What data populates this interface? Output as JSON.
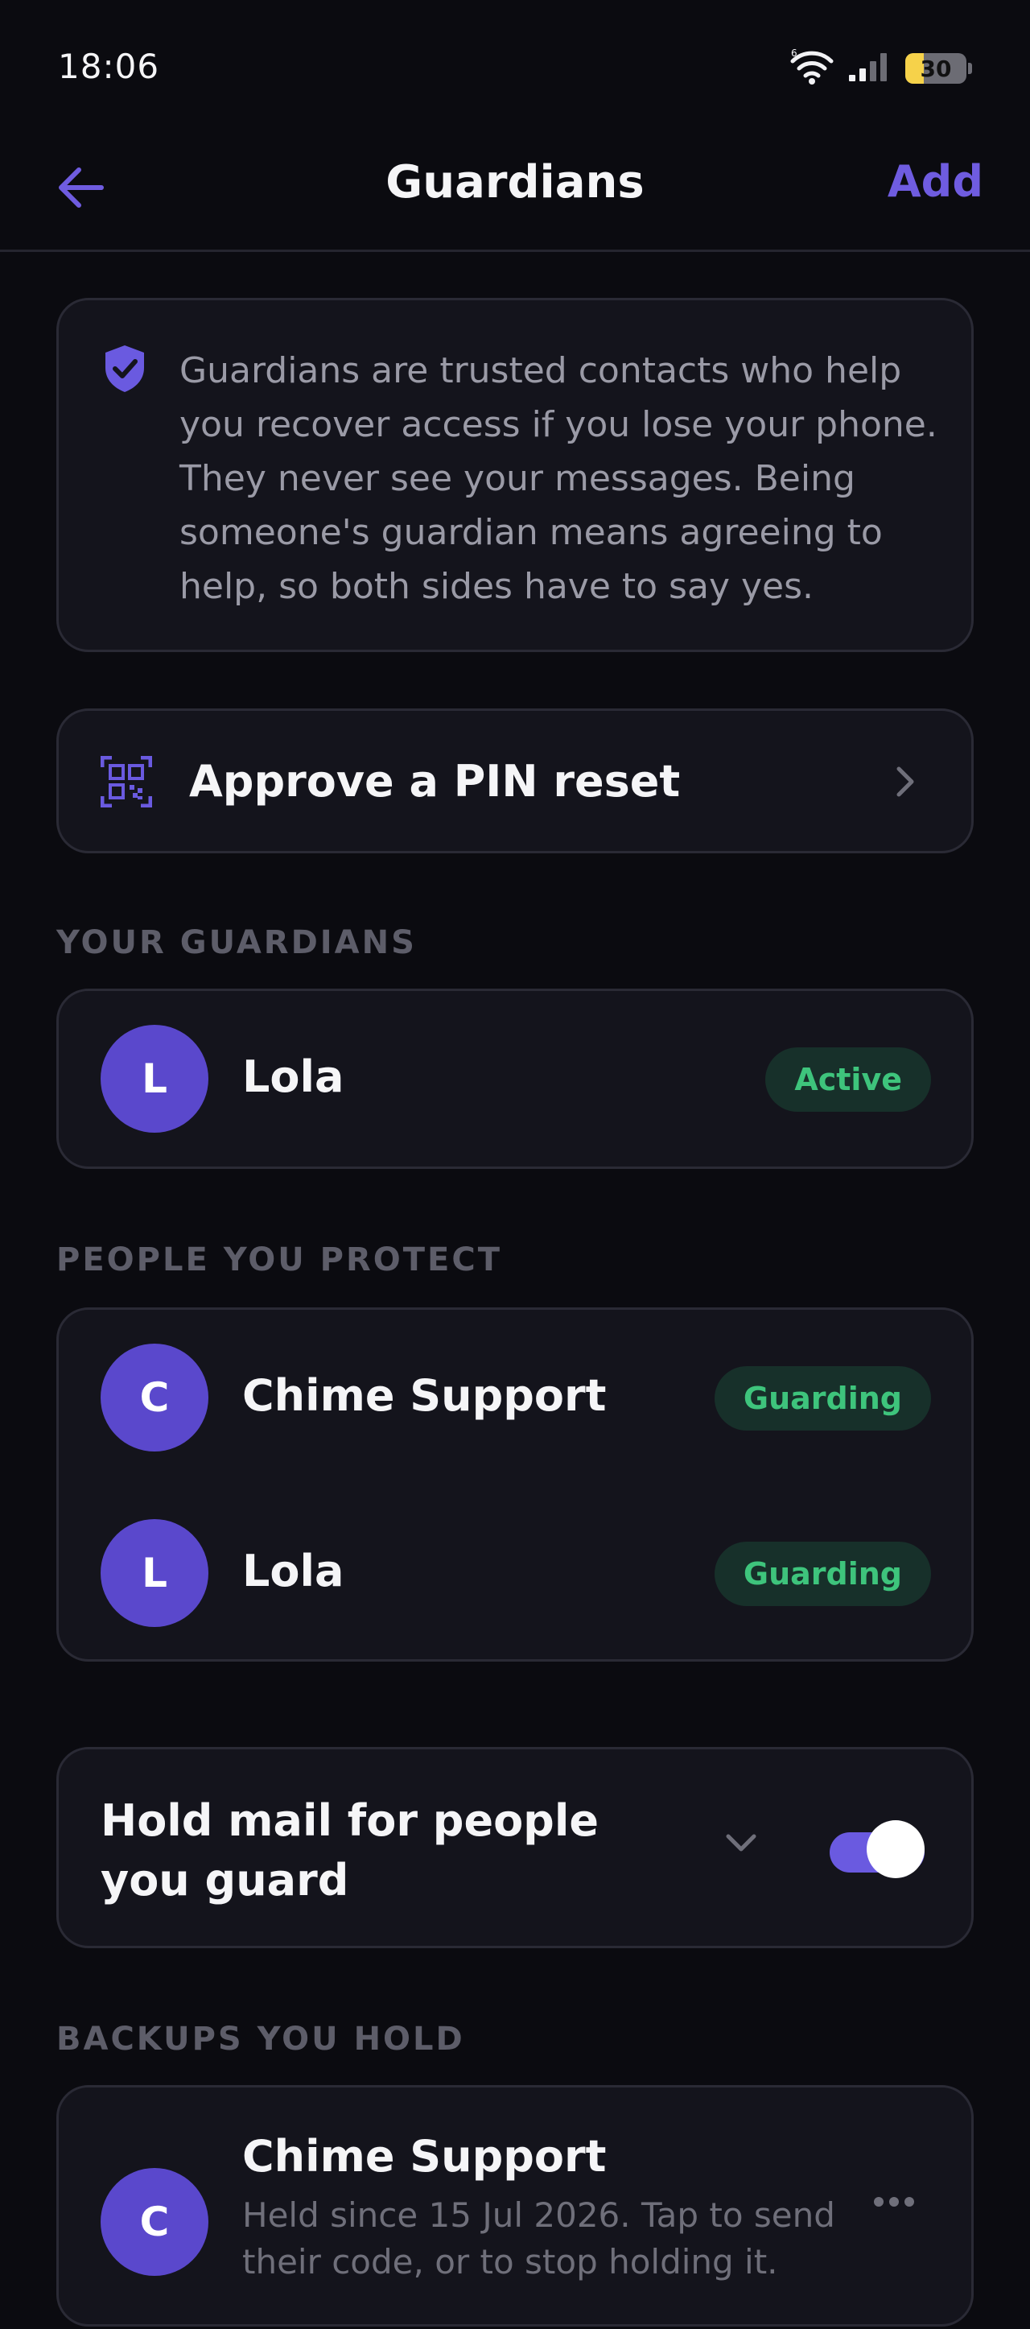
{
  "status_bar": {
    "time": "18:06",
    "battery_level": "30",
    "battery_percent": 30,
    "wifi_icon": "wifi-icon",
    "signal_icon": "cellular-signal-icon"
  },
  "header": {
    "title": "Guardians",
    "add_label": "Add",
    "back_icon": "arrow-left-icon"
  },
  "info": {
    "icon": "shield-check-icon",
    "text": "Guardians are trusted contacts who help you recover access if you lose your phone. They never see your messages. Being someone's guardian means agreeing to help, so both sides have to say yes."
  },
  "pin_reset": {
    "icon": "qr-code-icon",
    "label": "Approve a PIN reset"
  },
  "your_guardians": {
    "section_label": "YOUR GUARDIANS",
    "items": [
      {
        "initial": "L",
        "name": "Lola",
        "status": "Active"
      }
    ]
  },
  "people_you_protect": {
    "section_label": "PEOPLE YOU PROTECT",
    "items": [
      {
        "initial": "C",
        "name": "Chime Support",
        "status": "Guarding"
      },
      {
        "initial": "L",
        "name": "Lola",
        "status": "Guarding"
      }
    ]
  },
  "hold_mail": {
    "label": "Hold mail for people you guard",
    "enabled": true
  },
  "backups_you_hold": {
    "section_label": "BACKUPS YOU HOLD",
    "items": [
      {
        "initial": "C",
        "name": "Chime Support",
        "description": "Held since 15 Jul 2026. Tap to send their code, or to stop holding it."
      }
    ]
  },
  "colors": {
    "background": "#0b0b10",
    "card": "#14141c",
    "accent": "#6f5ce0",
    "badge_text": "#3ec47c",
    "badge_bg": "#17302a",
    "battery": "#f6d24a"
  }
}
